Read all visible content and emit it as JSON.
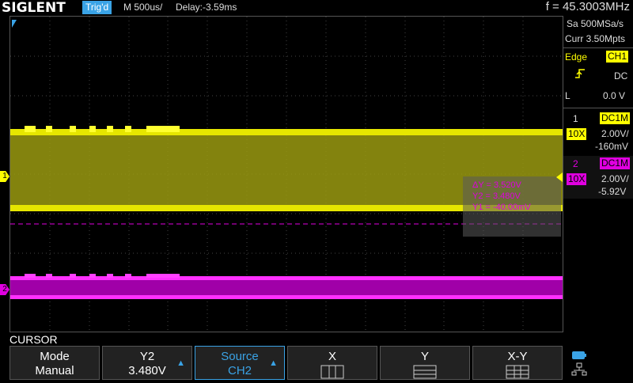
{
  "topbar": {
    "brand": "SIGLENT",
    "trig_status": "Trig'd",
    "timebase": "M 500us/",
    "delay": "Delay:-3.59ms",
    "frequency": "f = 45.3003MHz"
  },
  "acquisition": {
    "sample_rate": "Sa 500MSa/s",
    "memory": "Curr 3.50Mpts"
  },
  "trigger": {
    "type_label": "Edge",
    "source": "CH1",
    "coupling": "DC",
    "level_label": "L",
    "level_value": "0.0 V"
  },
  "channels": [
    {
      "number": "1",
      "coupling": "DC1M",
      "probe": "10X",
      "scale": "2.00V/",
      "offset": "-160mV",
      "color": "#ffff00"
    },
    {
      "number": "2",
      "coupling": "DC1M",
      "probe": "10X",
      "scale": "2.00V/",
      "offset": "-5.92V",
      "color": "#e000e0"
    }
  ],
  "cursor_readout": {
    "delta": "ΔY = 3.520V",
    "y2": "Y2 = 3.480V",
    "y1": "Y1 = -40.00mV"
  },
  "waveforms": {
    "ch1_marker": "1",
    "ch2_marker": "2"
  },
  "menu": {
    "title": "CURSOR",
    "buttons": [
      {
        "label": "Mode",
        "value": "Manual"
      },
      {
        "label": "Y2",
        "value": "3.480V"
      },
      {
        "label": "Source",
        "value": "CH2"
      },
      {
        "label": "X",
        "value": ""
      },
      {
        "label": "Y",
        "value": ""
      },
      {
        "label": "X-Y",
        "value": ""
      }
    ]
  }
}
